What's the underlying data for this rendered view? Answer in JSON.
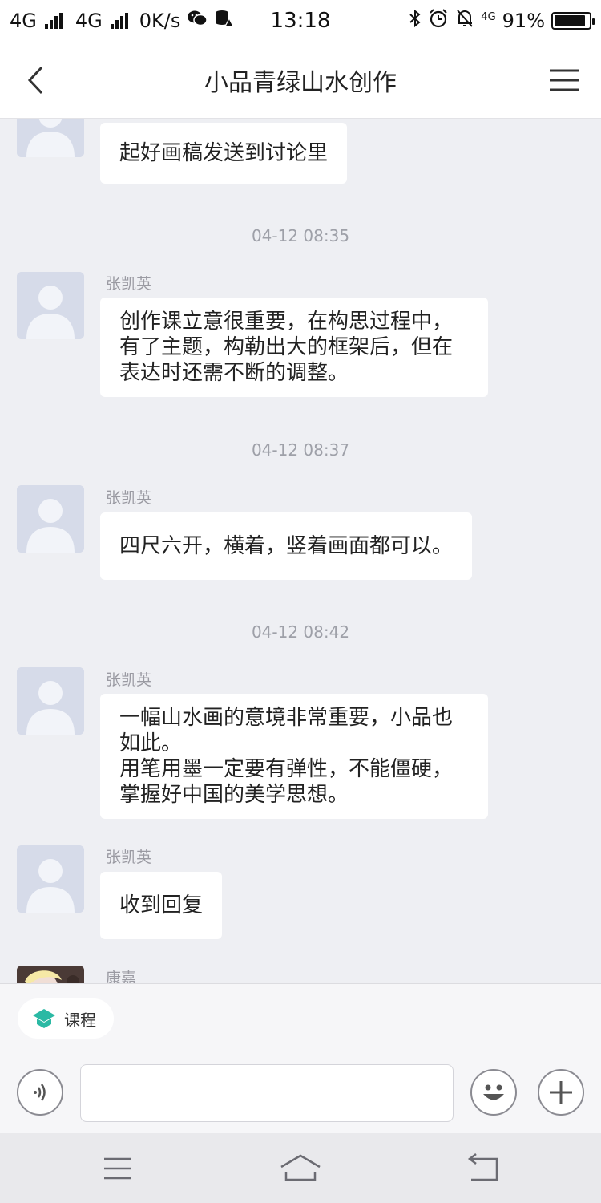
{
  "status_bar": {
    "network1": "4G",
    "network2": "4G",
    "speed": "0K/s",
    "time": "13:18",
    "network3": "4G",
    "battery": "91%",
    "battery_level": 0.91
  },
  "header": {
    "title": "小品青绿山水创作"
  },
  "messages": [
    {
      "sender": "",
      "text": "起好画稿发送到讨论里"
    },
    {
      "timestamp": "04-12 08:35"
    },
    {
      "sender": "张凯英",
      "text": "创作课立意很重要，在构思过程中，\n有了主题，构勒出大的框架后，但在\n表达时还需不断的调整。"
    },
    {
      "timestamp": "04-12 08:37"
    },
    {
      "sender": "张凯英",
      "text": "四尺六开，横着，竖着画面都可以。"
    },
    {
      "timestamp": "04-12 08:42"
    },
    {
      "sender": "张凯英",
      "text": "一幅山水画的意境非常重要，小品也\n如此。\n用笔用墨一定要有弹性，不能僵硬，\n掌握好中国的美学思想。"
    },
    {
      "sender": "张凯英",
      "text": "收到回复"
    },
    {
      "sender": "康嘉"
    }
  ],
  "composer": {
    "course_label": "课程",
    "input_value": "",
    "input_placeholder": ""
  },
  "colors": {
    "chat_bg": "#eeeff3",
    "course_icon": "#2bb9a4"
  }
}
